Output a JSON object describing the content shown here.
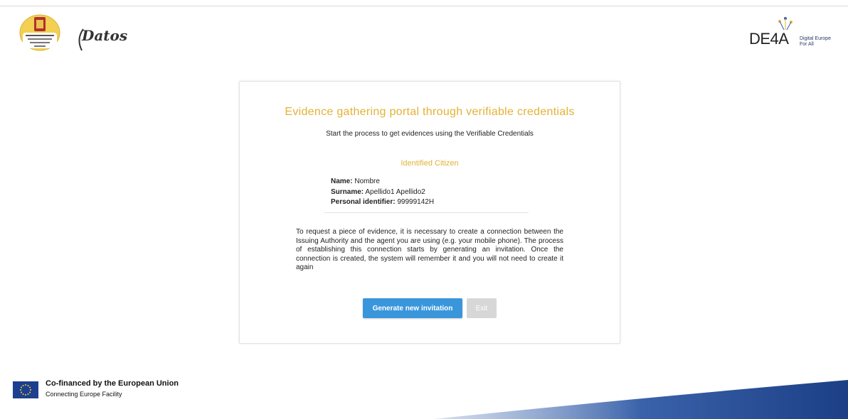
{
  "header": {
    "datos_logo_text": "Datos",
    "de4a_logo_text": "DE4A",
    "de4a_tagline_1": "Digital Europe",
    "de4a_tagline_2": "For All"
  },
  "card": {
    "title": "Evidence gathering portal through verifiable credentials",
    "subtitle": "Start the process to get evidences using the Verifiable Credentials",
    "section_title": "Identified Citizen",
    "citizen": {
      "name_label": "Name:",
      "name_value": "Nombre",
      "surname_label": "Surname:",
      "surname_value": "Apellido1 Apellido2",
      "id_label": "Personal identifier:",
      "id_value": "99999142H"
    },
    "info_text": "To request a piece of evidence, it is necessary to create a connection between the Issuing Authority and the agent you are using (e.g. your mobile phone). The process of establishing this connection starts by generating an invitation. Once the connection is created, the system will remember it and you will not need to create it again",
    "generate_button": "Generate new invitation",
    "exit_button": "Exit"
  },
  "footer": {
    "cofinanced": "Co-financed by the European Union",
    "facility": "Connecting Europe Facility"
  },
  "colors": {
    "accent_gold": "#e2b234",
    "primary_button": "#3a96db",
    "disabled_button": "#d7d7d7",
    "eu_blue": "#1d3f8f",
    "swoosh_blue": "#244a92"
  }
}
